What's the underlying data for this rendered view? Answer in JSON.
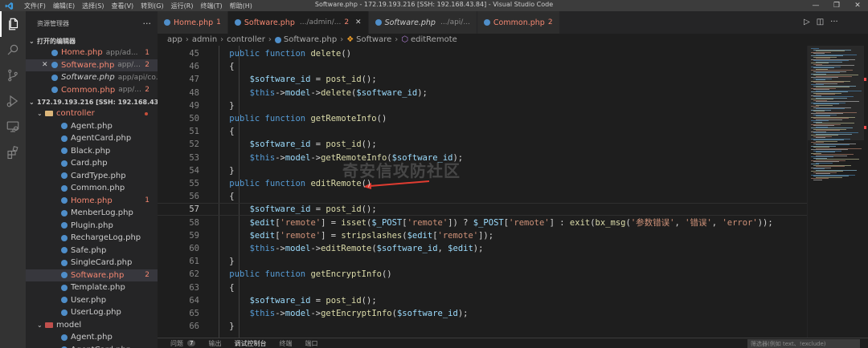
{
  "window": {
    "title": "Software.php - 172.19.193.216 [SSH: 192.168.43.84] - Visual Studio Code",
    "logo": "vscode-logo"
  },
  "menu": [
    "文件(F)",
    "编辑(E)",
    "选择(S)",
    "查看(V)",
    "转到(G)",
    "运行(R)",
    "终端(T)",
    "帮助(H)"
  ],
  "activity_bar": [
    "files-icon",
    "search-icon",
    "source-control-icon",
    "run-debug-icon",
    "remote-explorer-icon",
    "extensions-icon"
  ],
  "sidebar": {
    "title": "资源管理器",
    "open_editors_label": "打开的编辑器",
    "open_editors": [
      {
        "name": "Home.php",
        "path": "app/ad...",
        "badge": "1",
        "error": true
      },
      {
        "name": "Software.php",
        "path": "app/...",
        "badge": "2",
        "error": true,
        "selected": true
      },
      {
        "name": "Software.php",
        "path": "app/api/co...",
        "badge": "",
        "error": false,
        "italic": true
      },
      {
        "name": "Common.php",
        "path": "app/...",
        "badge": "2",
        "error": true
      }
    ],
    "workspace_label": "172.19.193.216 [SSH: 192.168.43.84]",
    "controller_folder": "controller",
    "files": [
      {
        "name": "Agent.php",
        "badge": ""
      },
      {
        "name": "AgentCard.php",
        "badge": ""
      },
      {
        "name": "Black.php",
        "badge": ""
      },
      {
        "name": "Card.php",
        "badge": ""
      },
      {
        "name": "CardType.php",
        "badge": ""
      },
      {
        "name": "Common.php",
        "badge": ""
      },
      {
        "name": "Home.php",
        "badge": "1",
        "error": true
      },
      {
        "name": "MenberLog.php",
        "badge": ""
      },
      {
        "name": "Plugin.php",
        "badge": ""
      },
      {
        "name": "RechargeLog.php",
        "badge": ""
      },
      {
        "name": "Safe.php",
        "badge": ""
      },
      {
        "name": "SingleCard.php",
        "badge": ""
      },
      {
        "name": "Software.php",
        "badge": "2",
        "error": true,
        "selected": true
      },
      {
        "name": "Template.php",
        "badge": ""
      },
      {
        "name": "User.php",
        "badge": ""
      },
      {
        "name": "UserLog.php",
        "badge": ""
      }
    ],
    "model_folder": "model",
    "model_files": [
      {
        "name": "Agent.php"
      },
      {
        "name": "AgentCard.php"
      }
    ]
  },
  "tabs": [
    {
      "name": "Home.php",
      "path": "",
      "count": "1",
      "active": false,
      "italic": false
    },
    {
      "name": "Software.php",
      "path": ".../admin/...",
      "count": "2",
      "active": true,
      "italic": false
    },
    {
      "name": "Software.php",
      "path": ".../api/...",
      "count": "",
      "active": false,
      "italic": true
    },
    {
      "name": "Common.php",
      "path": "",
      "count": "2",
      "active": false,
      "italic": false
    }
  ],
  "breadcrumb": [
    "app",
    "admin",
    "controller",
    "Software.php",
    "Software",
    "editRemote"
  ],
  "editor": {
    "current_line": 57,
    "lines": [
      {
        "n": 45,
        "tokens": [
          [
            "    ",
            ""
          ],
          [
            "public function ",
            "k-blue"
          ],
          [
            "delete",
            "k-fn"
          ],
          [
            "()",
            ""
          ]
        ]
      },
      {
        "n": 46,
        "tokens": [
          [
            "    {",
            ""
          ]
        ]
      },
      {
        "n": 47,
        "tokens": [
          [
            "        ",
            ""
          ],
          [
            "$software_id",
            "k-var"
          ],
          [
            " = ",
            ""
          ],
          [
            "post_id",
            "k-fn"
          ],
          [
            "();",
            ""
          ]
        ]
      },
      {
        "n": 48,
        "tokens": [
          [
            "        ",
            ""
          ],
          [
            "$this",
            "k-blue"
          ],
          [
            "->",
            ""
          ],
          [
            "model",
            "k-var"
          ],
          [
            "->",
            ""
          ],
          [
            "delete",
            "k-fn"
          ],
          [
            "(",
            ""
          ],
          [
            "$software_id",
            "k-var"
          ],
          [
            ");",
            ""
          ]
        ]
      },
      {
        "n": 49,
        "tokens": [
          [
            "    }",
            ""
          ]
        ]
      },
      {
        "n": 50,
        "tokens": [
          [
            "    ",
            ""
          ],
          [
            "public function ",
            "k-blue"
          ],
          [
            "getRemoteInfo",
            "k-fn"
          ],
          [
            "()",
            ""
          ]
        ]
      },
      {
        "n": 51,
        "tokens": [
          [
            "    {",
            ""
          ]
        ]
      },
      {
        "n": 52,
        "tokens": [
          [
            "        ",
            ""
          ],
          [
            "$software_id",
            "k-var"
          ],
          [
            " = ",
            ""
          ],
          [
            "post_id",
            "k-fn"
          ],
          [
            "();",
            ""
          ]
        ]
      },
      {
        "n": 53,
        "tokens": [
          [
            "        ",
            ""
          ],
          [
            "$this",
            "k-blue"
          ],
          [
            "->",
            ""
          ],
          [
            "model",
            "k-var"
          ],
          [
            "->",
            ""
          ],
          [
            "getRemoteInfo",
            "k-fn"
          ],
          [
            "(",
            ""
          ],
          [
            "$software_id",
            "k-var"
          ],
          [
            ");",
            ""
          ]
        ]
      },
      {
        "n": 54,
        "tokens": [
          [
            "    }",
            ""
          ]
        ]
      },
      {
        "n": 55,
        "tokens": [
          [
            "    ",
            ""
          ],
          [
            "public function ",
            "k-blue"
          ],
          [
            "editRemote",
            "k-fn"
          ],
          [
            "()",
            ""
          ]
        ]
      },
      {
        "n": 56,
        "tokens": [
          [
            "    {",
            ""
          ]
        ]
      },
      {
        "n": 57,
        "tokens": [
          [
            "        ",
            ""
          ],
          [
            "$software_id",
            "k-var"
          ],
          [
            " = ",
            ""
          ],
          [
            "post_id",
            "k-fn"
          ],
          [
            "();",
            ""
          ]
        ]
      },
      {
        "n": 58,
        "tokens": [
          [
            "        ",
            ""
          ],
          [
            "$edit",
            "k-var"
          ],
          [
            "[",
            ""
          ],
          [
            "'remote'",
            "k-str"
          ],
          [
            "] = ",
            ""
          ],
          [
            "isset",
            "k-fn"
          ],
          [
            "(",
            ""
          ],
          [
            "$_POST",
            "k-var"
          ],
          [
            "[",
            ""
          ],
          [
            "'remote'",
            "k-str"
          ],
          [
            "]) ? ",
            ""
          ],
          [
            "$_POST",
            "k-var"
          ],
          [
            "[",
            ""
          ],
          [
            "'remote'",
            "k-str"
          ],
          [
            "] : ",
            ""
          ],
          [
            "exit",
            "k-fn"
          ],
          [
            "(",
            ""
          ],
          [
            "bx_msg",
            "k-fn"
          ],
          [
            "(",
            ""
          ],
          [
            "'参数错误'",
            "k-str"
          ],
          [
            ", ",
            ""
          ],
          [
            "'错误'",
            "k-str"
          ],
          [
            ", ",
            ""
          ],
          [
            "'error'",
            "k-str"
          ],
          [
            "));",
            ""
          ]
        ]
      },
      {
        "n": 59,
        "tokens": [
          [
            "        ",
            ""
          ],
          [
            "$edit",
            "k-var"
          ],
          [
            "[",
            ""
          ],
          [
            "'remote'",
            "k-str"
          ],
          [
            "] = ",
            ""
          ],
          [
            "stripslashes",
            "k-fn"
          ],
          [
            "(",
            ""
          ],
          [
            "$edit",
            "k-var"
          ],
          [
            "[",
            ""
          ],
          [
            "'remote'",
            "k-str"
          ],
          [
            "]);",
            ""
          ]
        ]
      },
      {
        "n": 60,
        "tokens": [
          [
            "        ",
            ""
          ],
          [
            "$this",
            "k-blue"
          ],
          [
            "->",
            ""
          ],
          [
            "model",
            "k-var"
          ],
          [
            "->",
            ""
          ],
          [
            "editRemote",
            "k-fn"
          ],
          [
            "(",
            ""
          ],
          [
            "$software_id",
            "k-var"
          ],
          [
            ", ",
            ""
          ],
          [
            "$edit",
            "k-var"
          ],
          [
            ");",
            ""
          ]
        ]
      },
      {
        "n": 61,
        "tokens": [
          [
            "    }",
            ""
          ]
        ]
      },
      {
        "n": 62,
        "tokens": [
          [
            "    ",
            ""
          ],
          [
            "public function ",
            "k-blue"
          ],
          [
            "getEncryptInfo",
            "k-fn"
          ],
          [
            "()",
            ""
          ]
        ]
      },
      {
        "n": 63,
        "tokens": [
          [
            "    {",
            ""
          ]
        ]
      },
      {
        "n": 64,
        "tokens": [
          [
            "        ",
            ""
          ],
          [
            "$software_id",
            "k-var"
          ],
          [
            " = ",
            ""
          ],
          [
            "post_id",
            "k-fn"
          ],
          [
            "();",
            ""
          ]
        ]
      },
      {
        "n": 65,
        "tokens": [
          [
            "        ",
            ""
          ],
          [
            "$this",
            "k-blue"
          ],
          [
            "->",
            ""
          ],
          [
            "model",
            "k-var"
          ],
          [
            "->",
            ""
          ],
          [
            "getEncryptInfo",
            "k-fn"
          ],
          [
            "(",
            ""
          ],
          [
            "$software_id",
            "k-var"
          ],
          [
            ");",
            ""
          ]
        ]
      },
      {
        "n": 66,
        "tokens": [
          [
            "    }",
            ""
          ]
        ]
      }
    ]
  },
  "watermark": "奇安信攻防社区",
  "panel": {
    "tabs": [
      {
        "label": "问题",
        "badge": "7",
        "active": false
      },
      {
        "label": "输出",
        "badge": "",
        "active": false
      },
      {
        "label": "调试控制台",
        "badge": "",
        "active": true
      },
      {
        "label": "终端",
        "badge": "",
        "active": false
      },
      {
        "label": "端口",
        "badge": "",
        "active": false
      }
    ],
    "filter_placeholder": "筛选器(例如 text、!exclude)"
  },
  "colors": {
    "accent": "#007acc",
    "error": "#f48771",
    "annotation_arrow": "#e03c31"
  }
}
